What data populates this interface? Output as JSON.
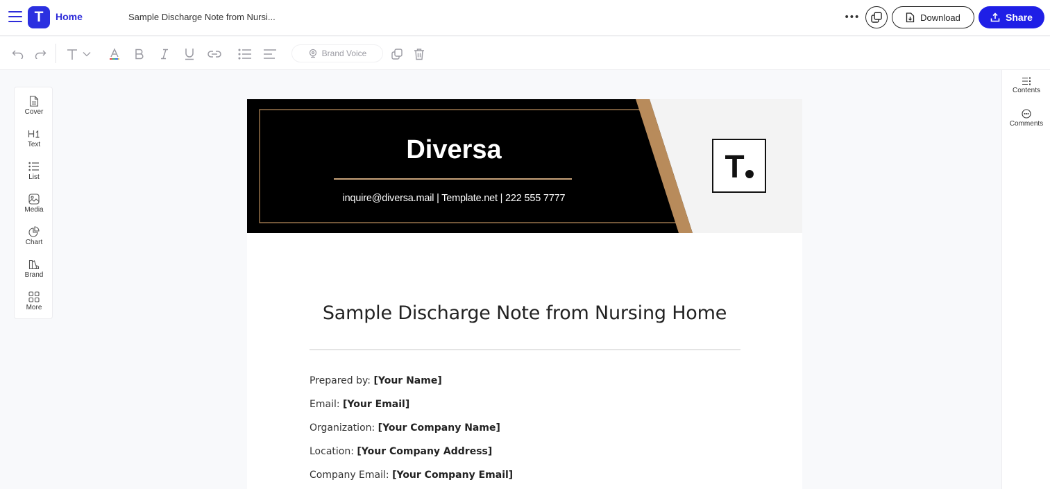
{
  "header": {
    "logo_letter": "T",
    "home_label": "Home",
    "doc_title": "Sample Discharge Note from Nursi...",
    "more_label": "•••",
    "download_label": "Download",
    "share_label": "Share"
  },
  "toolbar": {
    "brand_voice_label": "Brand Voice"
  },
  "left_panel": {
    "items": [
      {
        "label": "Cover"
      },
      {
        "label": "Text"
      },
      {
        "label": "List"
      },
      {
        "label": "Media"
      },
      {
        "label": "Chart"
      },
      {
        "label": "Brand"
      },
      {
        "label": "More"
      }
    ]
  },
  "right_panel": {
    "items": [
      {
        "label": "Contents"
      },
      {
        "label": "Comments"
      }
    ]
  },
  "document": {
    "banner": {
      "brand_name": "Diversa",
      "contact": "inquire@diversa.mail  |  Template.net  |  222 555 7777",
      "logo_text": "T"
    },
    "title": "Sample Discharge Note from Nursing Home",
    "fields": [
      {
        "label": "Prepared by: ",
        "value": "[Your Name]"
      },
      {
        "label": "Email: ",
        "value": "[Your Email]"
      },
      {
        "label": "Organization: ",
        "value": "[Your Company Name]"
      },
      {
        "label": "Location: ",
        "value": "[Your Company Address]"
      },
      {
        "label": "Company Email: ",
        "value": "[Your Company Email]"
      }
    ]
  },
  "colors": {
    "accent": "#2b30e0",
    "banner_black": "#000000",
    "banner_gold": "#b88b5b",
    "banner_gray": "#f3f3f3"
  }
}
